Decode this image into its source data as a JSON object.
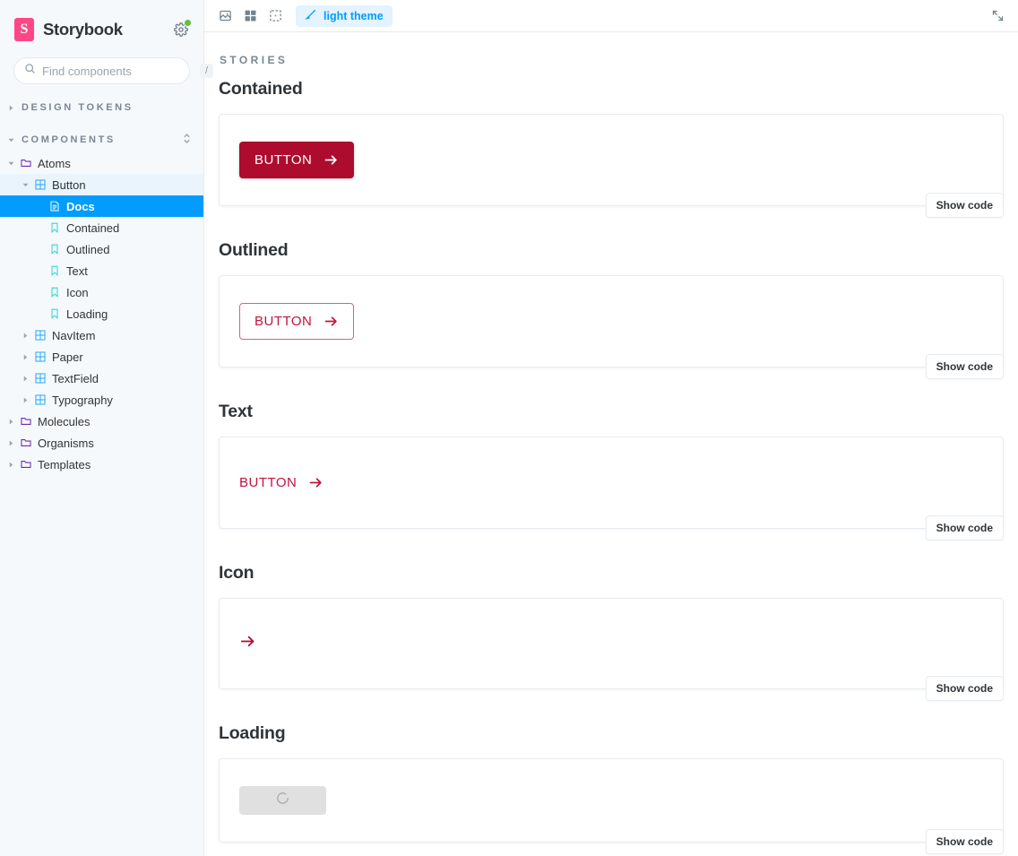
{
  "sidebar": {
    "brand": "Storybook",
    "logo_glyph": "S",
    "logo_color": "#ff4785",
    "search": {
      "placeholder": "Find components",
      "value": "",
      "shortcut": "/"
    },
    "groups": [
      {
        "label": "DESIGN TOKENS",
        "expanded": false
      },
      {
        "label": "COMPONENTS",
        "expanded": true
      }
    ],
    "items": [
      {
        "label": "Atoms",
        "kind": "folder",
        "depth": 0,
        "state": "expanded"
      },
      {
        "label": "Button",
        "kind": "component",
        "depth": 1,
        "state": "expanded-parent"
      },
      {
        "label": "Docs",
        "kind": "docs",
        "depth": 2,
        "state": "selected"
      },
      {
        "label": "Contained",
        "kind": "story",
        "depth": 2,
        "state": "normal"
      },
      {
        "label": "Outlined",
        "kind": "story",
        "depth": 2,
        "state": "normal"
      },
      {
        "label": "Text",
        "kind": "story",
        "depth": 2,
        "state": "normal"
      },
      {
        "label": "Icon",
        "kind": "story",
        "depth": 2,
        "state": "normal"
      },
      {
        "label": "Loading",
        "kind": "story",
        "depth": 2,
        "state": "normal"
      },
      {
        "label": "NavItem",
        "kind": "component",
        "depth": 1,
        "state": "collapsed"
      },
      {
        "label": "Paper",
        "kind": "component",
        "depth": 1,
        "state": "collapsed"
      },
      {
        "label": "TextField",
        "kind": "component",
        "depth": 1,
        "state": "collapsed"
      },
      {
        "label": "Typography",
        "kind": "component",
        "depth": 1,
        "state": "collapsed"
      },
      {
        "label": "Molecules",
        "kind": "folder",
        "depth": 0,
        "state": "collapsed"
      },
      {
        "label": "Organisms",
        "kind": "folder",
        "depth": 0,
        "state": "collapsed"
      },
      {
        "label": "Templates",
        "kind": "folder",
        "depth": 0,
        "state": "collapsed"
      }
    ]
  },
  "toolbar": {
    "buttons": [
      {
        "icon": "image-icon"
      },
      {
        "icon": "grid-icon"
      },
      {
        "icon": "outline-icon"
      }
    ],
    "theme": {
      "label": "light theme",
      "icon": "paintbrush-icon",
      "active": true,
      "accent": "#029cfd"
    },
    "fullscreen_icon": "expand-icon"
  },
  "docs": {
    "section_label": "STORIES",
    "show_code_label": "Show code",
    "accent_dark": "#ad0c2e",
    "accent_light": "#c2143b",
    "stories": [
      {
        "title": "Contained",
        "variant": "contained",
        "button_label": "BUTTON"
      },
      {
        "title": "Outlined",
        "variant": "outlined",
        "button_label": "BUTTON"
      },
      {
        "title": "Text",
        "variant": "text",
        "button_label": "BUTTON"
      },
      {
        "title": "Icon",
        "variant": "icon",
        "button_label": ""
      },
      {
        "title": "Loading",
        "variant": "loading",
        "button_label": ""
      }
    ]
  }
}
